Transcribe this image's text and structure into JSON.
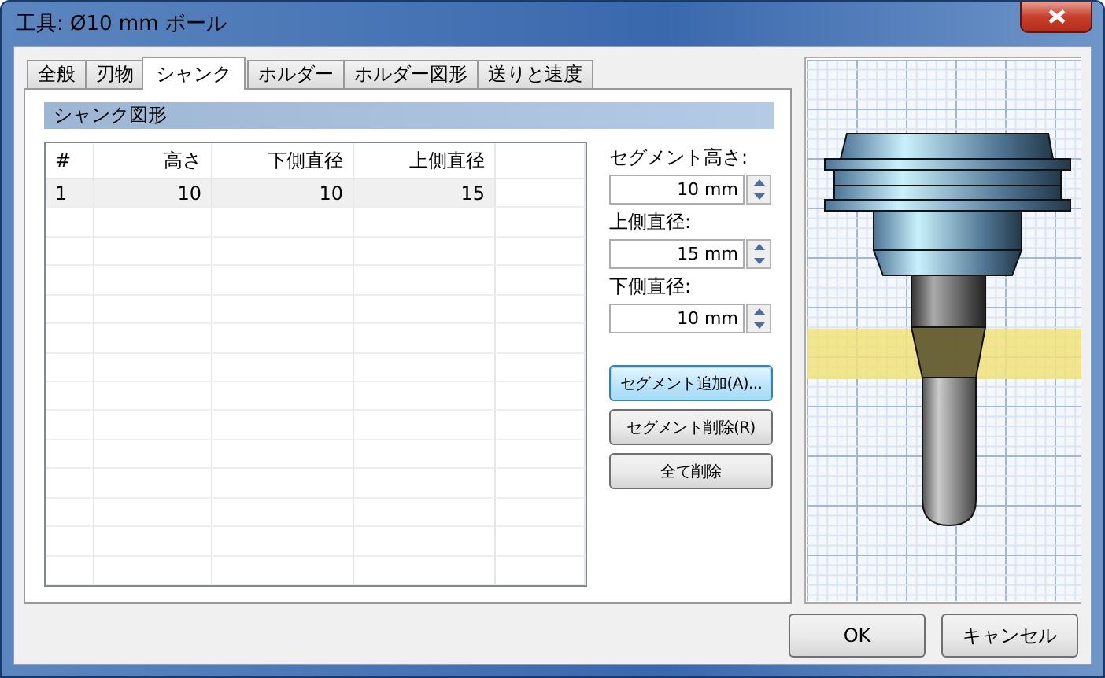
{
  "window": {
    "title": "工具: Ø10 mm ボール"
  },
  "tabs": [
    {
      "label": "全般",
      "selected": false
    },
    {
      "label": "刃物",
      "selected": false
    },
    {
      "label": "シャンク",
      "selected": true
    },
    {
      "label": "ホルダー",
      "selected": false
    },
    {
      "label": "ホルダー図形",
      "selected": false
    },
    {
      "label": "送りと速度",
      "selected": false
    }
  ],
  "section_title": "シャンク図形",
  "table": {
    "columns": [
      "#",
      "高さ",
      "下側直径",
      "上側直径"
    ],
    "rows": [
      {
        "cells": [
          "1",
          "10",
          "10",
          "15"
        ],
        "selected": true
      }
    ]
  },
  "fields": [
    {
      "label": "セグメント高さ:",
      "value": "10 mm"
    },
    {
      "label": "上側直径:",
      "value": "15 mm"
    },
    {
      "label": "下側直径:",
      "value": "10 mm"
    }
  ],
  "buttons": [
    {
      "label": "セグメント追加(A)...",
      "focused": true
    },
    {
      "label": "セグメント削除(R)",
      "focused": false
    },
    {
      "label": "全て削除",
      "focused": false
    }
  ],
  "dialog_buttons": [
    "OK",
    "キャンセル"
  ]
}
